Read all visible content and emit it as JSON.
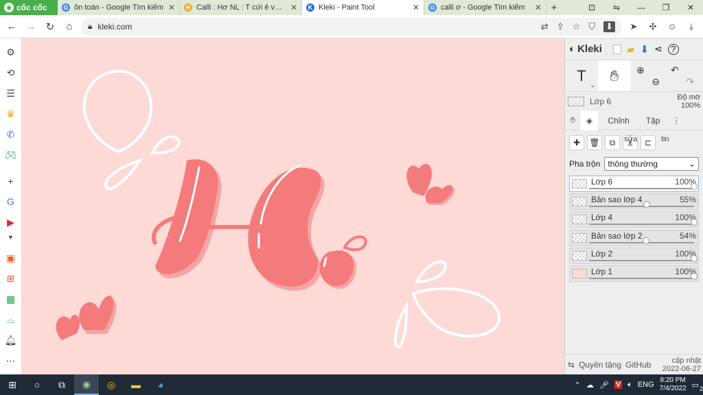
{
  "browser": {
    "brand": "cốc cốc",
    "tabs": [
      {
        "title": "ôn toán - Google Tìm kiếm",
        "favicon": "G",
        "color": "#4285f4"
      },
      {
        "title": "Calli : Hơ NL : T cứi ê với Mu",
        "favicon": "H",
        "color": "#f4a833"
      },
      {
        "title": "Kleki - Paint Tool",
        "favicon": "K",
        "color": "#2a6fd6",
        "active": true
      },
      {
        "title": "calli ơ - Google Tìm kiếm",
        "favicon": "G",
        "color": "#4285f4"
      }
    ],
    "new_tab": "+",
    "url": "kleki.com"
  },
  "kleki": {
    "brand": "Kleki",
    "current_layer": {
      "name": "Lớp 6",
      "opacity_label": "Độ mờ",
      "opacity": "100%"
    },
    "tabs": [
      "Chỉnh",
      "Tập"
    ],
    "tab_extra": [
      "sửa",
      "tin"
    ],
    "blend": {
      "label": "Pha trộn",
      "value": "thông thường"
    },
    "layers": [
      {
        "name": "Lớp 6",
        "opacity": "100%",
        "value": 1.0,
        "selected": true
      },
      {
        "name": "Bản sao lớp 4",
        "opacity": "55%",
        "value": 0.55
      },
      {
        "name": "Lớp 4",
        "opacity": "100%",
        "value": 1.0
      },
      {
        "name": "Bản sao lớp 2",
        "opacity": "54%",
        "value": 0.54
      },
      {
        "name": "Lớp 2",
        "opacity": "100%",
        "value": 1.0
      },
      {
        "name": "Lớp 1",
        "opacity": "100%",
        "value": 1.0,
        "fill": "#fddad6"
      }
    ],
    "footer": {
      "donate": "Quyên tặng",
      "github": "GitHub",
      "update_label": "cập nhật",
      "update_date": "2022-06-27"
    }
  },
  "taskbar": {
    "lang": "ENG",
    "time": "8:20 PM",
    "date": "7/4/2022",
    "badge": "2"
  }
}
